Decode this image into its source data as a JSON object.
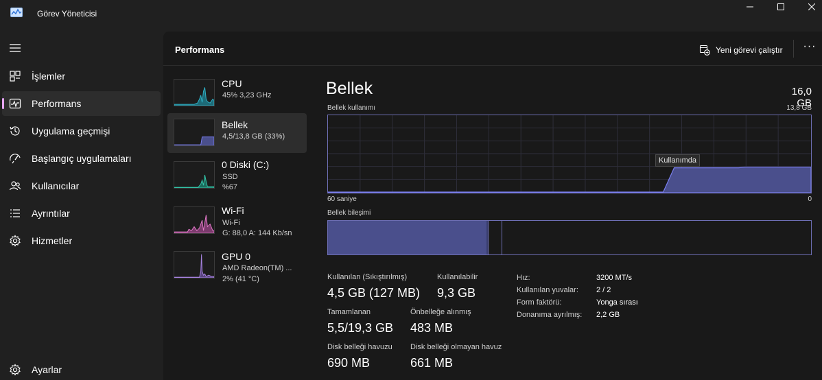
{
  "window": {
    "title": "Görev Yöneticisi",
    "controls": [
      "minimize-icon",
      "maximize-icon",
      "close-icon"
    ]
  },
  "sidebar": {
    "items": [
      {
        "label": "İşlemler",
        "icon": "processes-icon",
        "active": false
      },
      {
        "label": "Performans",
        "icon": "performance-icon",
        "active": true
      },
      {
        "label": "Uygulama geçmişi",
        "icon": "app-history-icon",
        "active": false
      },
      {
        "label": "Başlangıç uygulamaları",
        "icon": "startup-icon",
        "active": false
      },
      {
        "label": "Kullanıcılar",
        "icon": "users-icon",
        "active": false
      },
      {
        "label": "Ayrıntılar",
        "icon": "details-icon",
        "active": false
      },
      {
        "label": "Hizmetler",
        "icon": "services-icon",
        "active": false
      }
    ],
    "settings_label": "Ayarlar"
  },
  "header": {
    "title": "Performans",
    "run_task_label": "Yeni görevi çalıştır",
    "more_label": "···"
  },
  "devices": [
    {
      "name": "CPU",
      "line1": "45% 3,23 GHz",
      "line2": "",
      "color": "#2fb3c8",
      "active": false
    },
    {
      "name": "Bellek",
      "line1": "4,5/13,8 GB (33%)",
      "line2": "",
      "color": "#7a7ff0",
      "active": true
    },
    {
      "name": "0 Diski (C:)",
      "line1": "SSD",
      "line2": "%67",
      "color": "#34c3a8",
      "active": false
    },
    {
      "name": "Wi-Fi",
      "line1": "Wi-Fi",
      "line2": "G: 88,0 A: 144 Kb/sn",
      "color": "#e27ac9",
      "active": false
    },
    {
      "name": "GPU 0",
      "line1": "AMD Radeon(TM) ...",
      "line2": "2% (41 °C)",
      "color": "#a783e0",
      "active": false
    }
  ],
  "detail": {
    "title": "Bellek",
    "total": "16,0 GB",
    "usage_label": "Bellek kullanımı",
    "usage_max": "13,8 GB",
    "time_left": "60 saniye",
    "time_right": "0",
    "in_use_tooltip": "Kullanımda",
    "composition_label": "Bellek bileşimi",
    "stats": [
      {
        "label": "Kullanılan (Sıkıştırılmış)",
        "value": "4,5 GB (127 MB)"
      },
      {
        "label": "Kullanılabilir",
        "value": "9,3 GB"
      },
      {
        "label": "Tamamlanan",
        "value": "5,5/19,3 GB"
      },
      {
        "label": "Önbelleğe alınmış",
        "value": "483 MB"
      },
      {
        "label": "Disk belleği havuzu",
        "value": "690 MB"
      },
      {
        "label": "Disk belleği olmayan havuz",
        "value": "661 MB"
      }
    ],
    "properties": [
      {
        "key": "Hız:",
        "value": "3200 MT/s"
      },
      {
        "key": "Kullanılan yuvalar:",
        "value": "2 / 2"
      },
      {
        "key": "Form faktörü:",
        "value": "Yonga sırası"
      },
      {
        "key": "Donanıma ayrılmış:",
        "value": "2,2 GB"
      }
    ]
  },
  "colors": {
    "accent": "#e8a6ff",
    "memory_fill": "#4a4f8c",
    "memory_line": "#6e6fb5"
  }
}
